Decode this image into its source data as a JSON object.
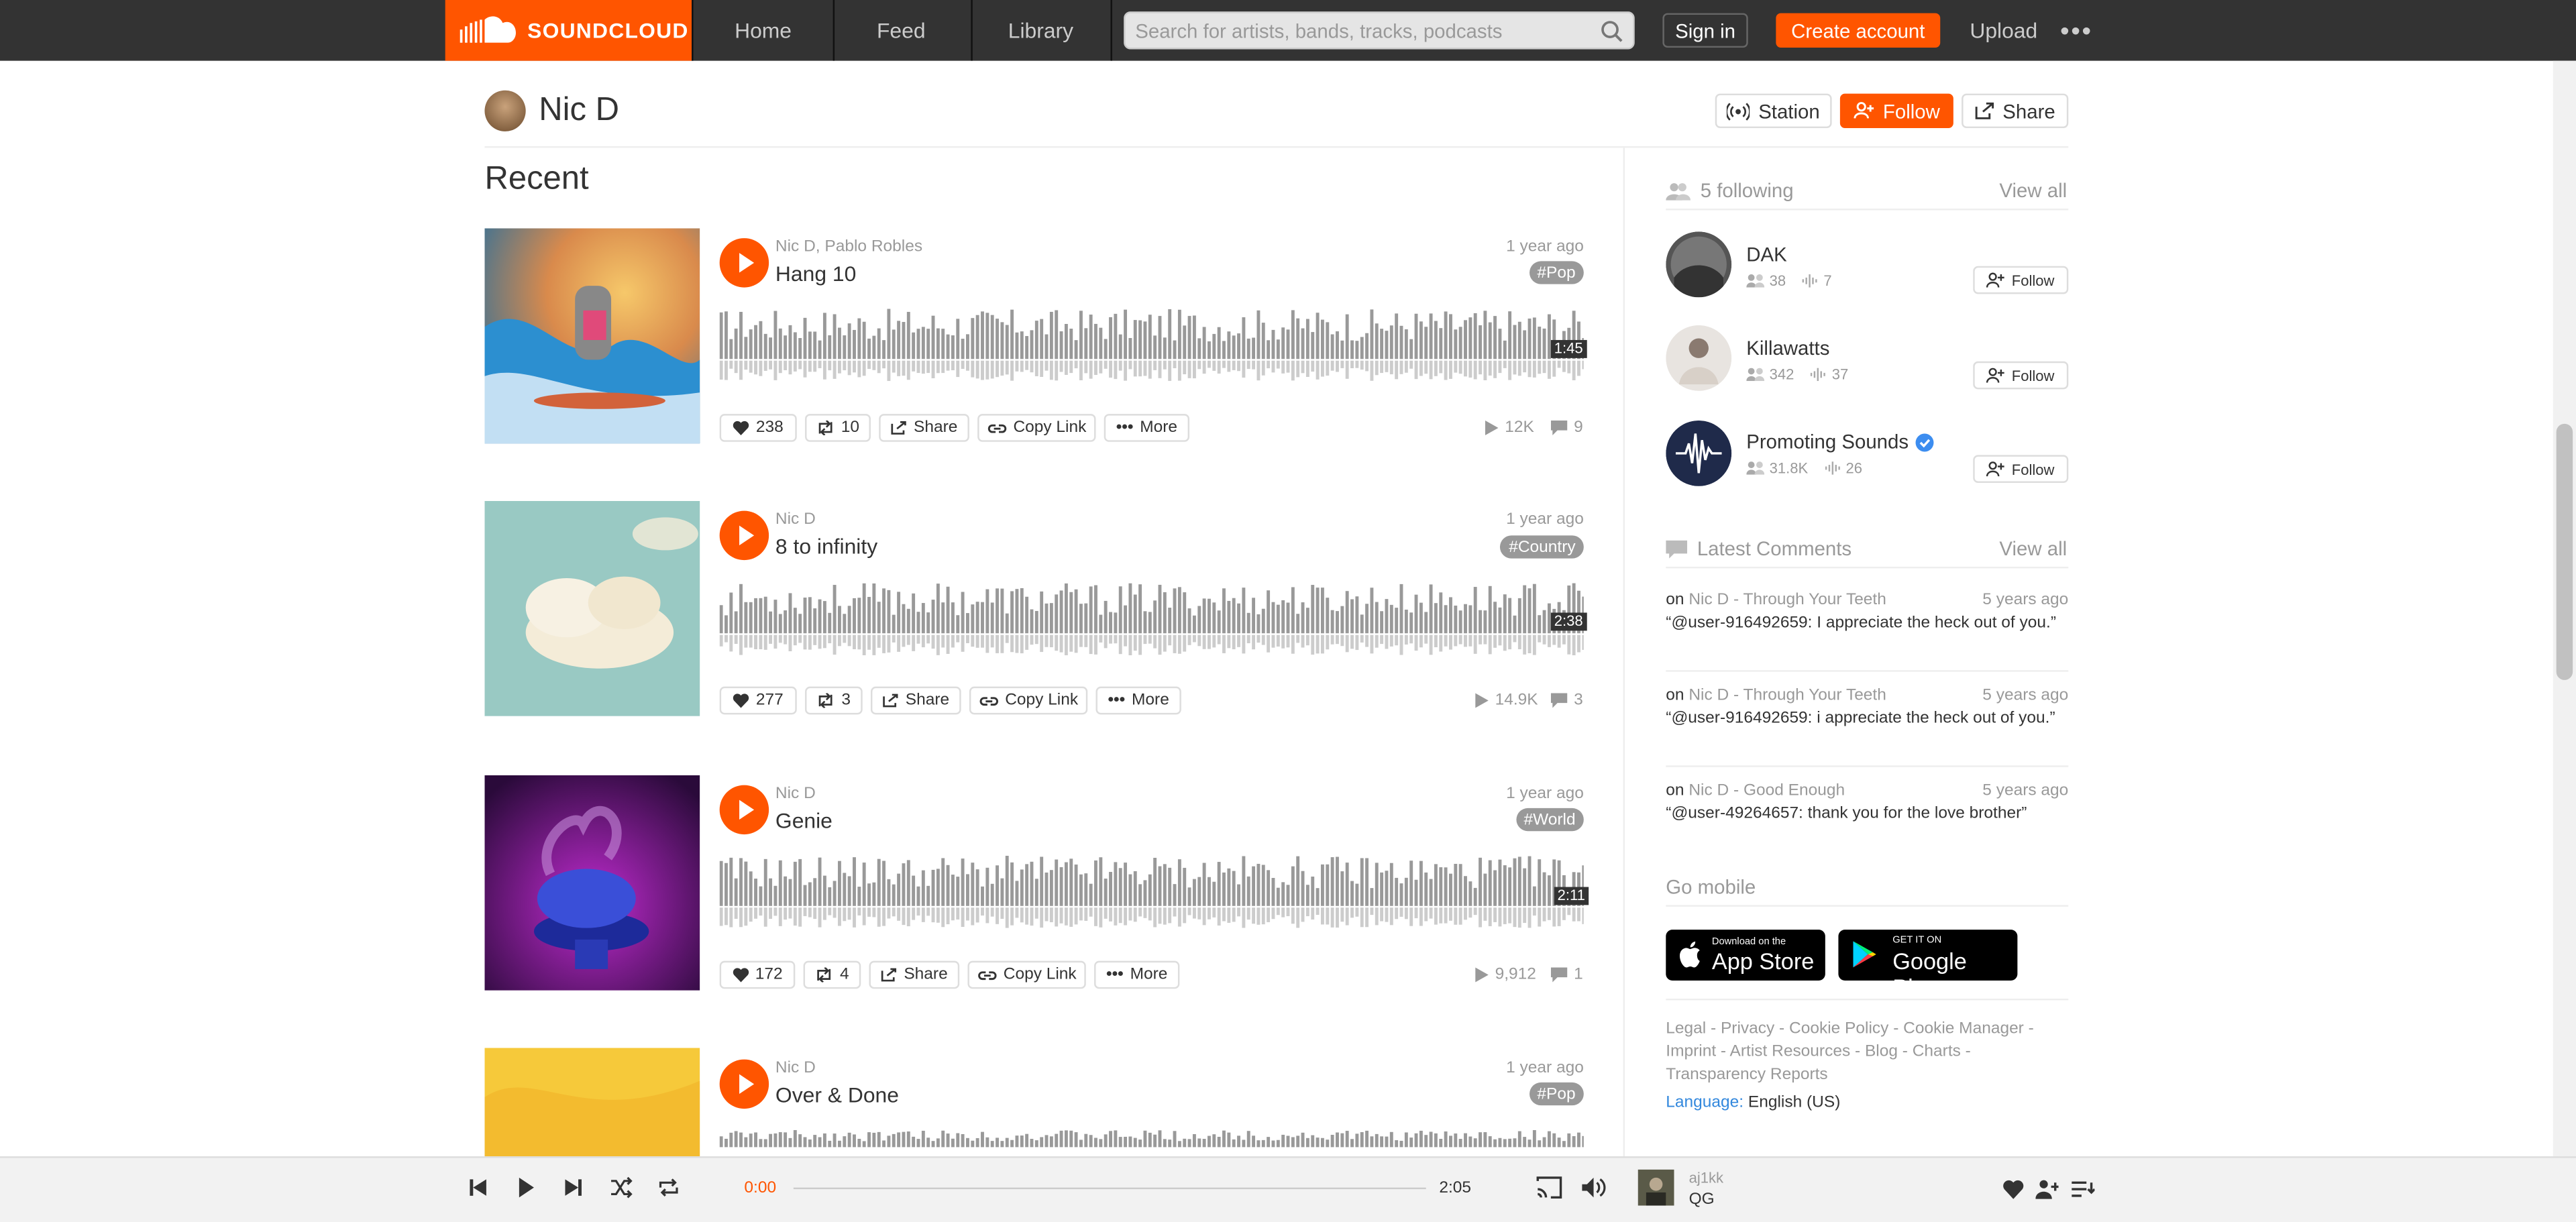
{
  "header": {
    "logo_text": "SOUNDCLOUD",
    "nav": [
      "Home",
      "Feed",
      "Library"
    ],
    "search_placeholder": "Search for artists, bands, tracks, podcasts",
    "sign_in": "Sign in",
    "create_account": "Create account",
    "upload": "Upload",
    "more": "•••"
  },
  "profile": {
    "name": "Nic D",
    "station": "Station",
    "follow": "Follow",
    "share": "Share"
  },
  "recent_heading": "Recent",
  "tracks": [
    {
      "artist": "Nic D, Pablo Robles",
      "title": "Hang 10",
      "age": "1 year ago",
      "tag": "Pop",
      "duration": "1:45",
      "likes": "238",
      "reposts": "10",
      "plays": "12K",
      "comments": "9"
    },
    {
      "artist": "Nic D",
      "title": "8 to infinity",
      "age": "1 year ago",
      "tag": "Country",
      "duration": "2:38",
      "likes": "277",
      "reposts": "3",
      "plays": "14.9K",
      "comments": "3"
    },
    {
      "artist": "Nic D",
      "title": "Genie",
      "age": "1 year ago",
      "tag": "World",
      "duration": "2:11",
      "likes": "172",
      "reposts": "4",
      "plays": "9,912",
      "comments": "1"
    },
    {
      "artist": "Nic D",
      "title": "Over & Done",
      "age": "1 year ago",
      "tag": "Pop"
    }
  ],
  "track_actions": {
    "share": "Share",
    "copy_link": "Copy Link",
    "more": "More"
  },
  "sidebar": {
    "following_label": "5 following",
    "view_all": "View all",
    "follow_btn": "Follow",
    "users": [
      {
        "name": "DAK",
        "followers": "38",
        "tracks": "7"
      },
      {
        "name": "Killawatts",
        "followers": "342",
        "tracks": "37"
      },
      {
        "name": "Promoting Sounds",
        "followers": "31.8K",
        "tracks": "26",
        "verified": true
      }
    ],
    "comments_label": "Latest Comments",
    "comments": [
      {
        "on": "on",
        "track": "Nic D - Through Your Teeth",
        "ago": "5 years ago",
        "text": "“@user-916492659: I appreciate the heck out of you.”"
      },
      {
        "on": "on",
        "track": "Nic D - Through Your Teeth",
        "ago": "5 years ago",
        "text": "“@user-916492659: i appreciate the heck out of you.”"
      },
      {
        "on": "on",
        "track": "Nic D - Good Enough",
        "ago": "5 years ago",
        "text": "“@user-49264657: thank you for the love brother”"
      }
    ],
    "go_mobile": "Go mobile",
    "appstore_small": "Download on the",
    "appstore_big": "App Store",
    "gplay_small": "GET IT ON",
    "gplay_big": "Google Play",
    "footer_links": "Legal - Privacy - Cookie Policy - Cookie Manager - Imprint - Artist Resources - Blog - Charts - Transparency Reports",
    "language_label": "Language:",
    "language_value": "English (US)"
  },
  "player": {
    "elapsed": "0:00",
    "total": "2:05",
    "progress": 0,
    "uploader": "aj1kk",
    "track": "QG"
  },
  "colors": {
    "accent": "#ff5500",
    "header": "#333333"
  }
}
